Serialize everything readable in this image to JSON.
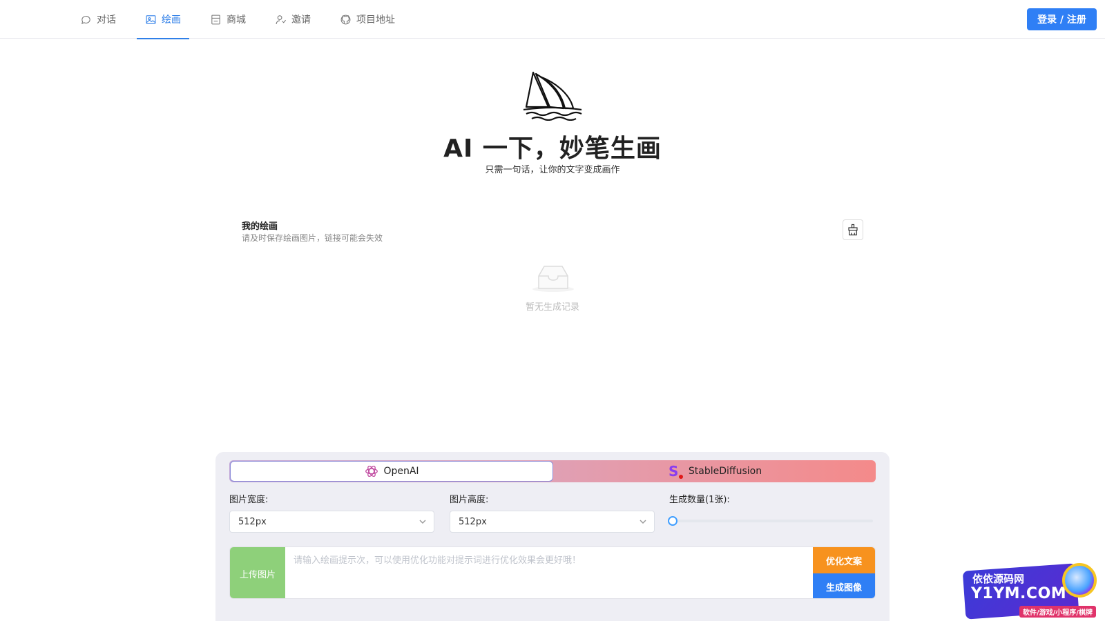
{
  "nav": {
    "items": [
      {
        "label": "对话",
        "icon": "chat-icon"
      },
      {
        "label": "绘画",
        "icon": "image-icon",
        "active": true
      },
      {
        "label": "商城",
        "icon": "store-icon"
      },
      {
        "label": "邀请",
        "icon": "invite-icon"
      },
      {
        "label": "项目地址",
        "icon": "github-icon"
      }
    ],
    "login_label": "登录 / 注册"
  },
  "hero": {
    "title": "AI 一下，妙笔生画",
    "subtitle": "只需一句话，让你的文字变成画作"
  },
  "gallery": {
    "title": "我的绘画",
    "description": "请及时保存绘画图片，链接可能会失效",
    "empty_text": "暂无生成记录",
    "clear_icon": "broom-icon"
  },
  "generator": {
    "engines": [
      {
        "label": "OpenAI",
        "active": true
      },
      {
        "label": "StableDiffusion",
        "active": false
      }
    ],
    "width_label": "图片宽度:",
    "width_value": "512px",
    "height_label": "图片高度:",
    "height_value": "512px",
    "count_label": "生成数量(1张):",
    "count_value": 1,
    "upload_label": "上传图片",
    "prompt_placeholder": "请输入绘画提示次，可以使用优化功能对提示词进行优化效果会更好哦！",
    "optimize_label": "优化文案",
    "generate_label": "生成图像",
    "colors": {
      "primary": "#2f7ff5",
      "upload": "#8ed07a",
      "optimize": "#f7921e"
    }
  },
  "watermark": {
    "line1": "依依源码网",
    "line2": "Y1YM.COM",
    "line3": "软件/游戏/小程序/棋牌"
  }
}
